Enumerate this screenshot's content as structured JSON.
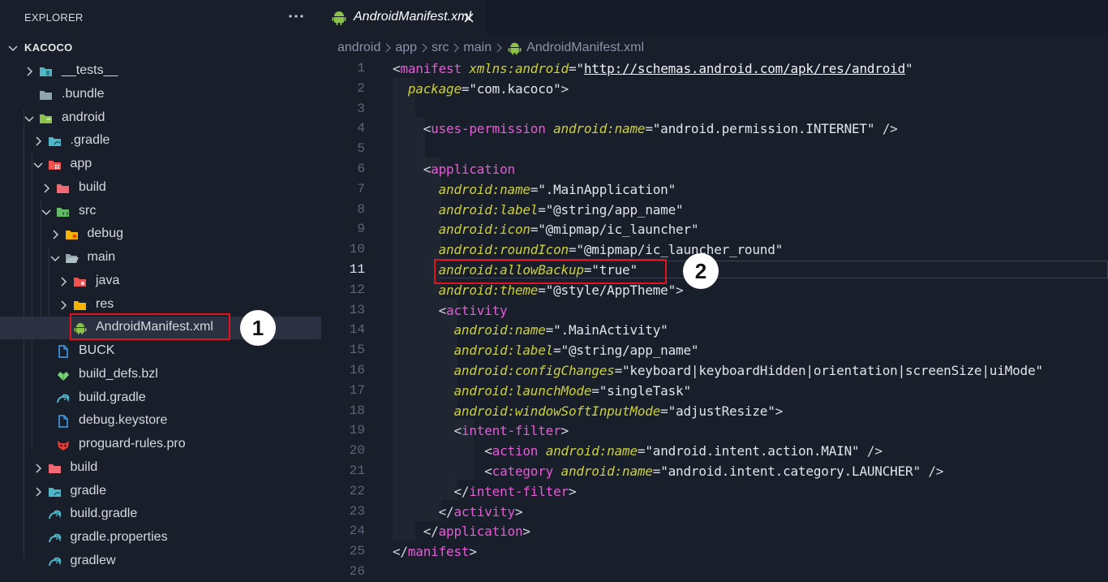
{
  "sidebar": {
    "title": "EXPLORER",
    "project": "KACOCO",
    "items": [
      {
        "label": "__tests__",
        "icon": "tests-folder-icon",
        "chevron": "right"
      },
      {
        "label": ".bundle",
        "icon": "folder-icon",
        "chevron": "none"
      },
      {
        "label": "android",
        "icon": "android-folder-icon",
        "chevron": "down"
      },
      {
        "label": ".gradle",
        "icon": "gradle-folder-icon",
        "chevron": "right"
      },
      {
        "label": "app",
        "icon": "app-folder-icon",
        "chevron": "down"
      },
      {
        "label": "build",
        "icon": "build-folder-icon",
        "chevron": "right"
      },
      {
        "label": "src",
        "icon": "src-folder-icon",
        "chevron": "down"
      },
      {
        "label": "debug",
        "icon": "debug-folder-icon",
        "chevron": "right"
      },
      {
        "label": "main",
        "icon": "open-folder-icon",
        "chevron": "down"
      },
      {
        "label": "java",
        "icon": "java-folder-icon",
        "chevron": "right"
      },
      {
        "label": "res",
        "icon": "res-folder-icon",
        "chevron": "right"
      },
      {
        "label": "AndroidManifest.xml",
        "icon": "android-icon",
        "chevron": "none"
      },
      {
        "label": "BUCK",
        "icon": "file-icon",
        "chevron": "none"
      },
      {
        "label": "build_defs.bzl",
        "icon": "bazel-icon",
        "chevron": "none"
      },
      {
        "label": "build.gradle",
        "icon": "gradle-icon",
        "chevron": "none"
      },
      {
        "label": "debug.keystore",
        "icon": "file-icon",
        "chevron": "none"
      },
      {
        "label": "proguard-rules.pro",
        "icon": "proguard-icon",
        "chevron": "none"
      },
      {
        "label": "build",
        "icon": "build-folder-icon",
        "chevron": "right"
      },
      {
        "label": "gradle",
        "icon": "gradle-folder-icon",
        "chevron": "right"
      },
      {
        "label": "build.gradle",
        "icon": "gradle-icon",
        "chevron": "none"
      },
      {
        "label": "gradle.properties",
        "icon": "gradle-icon",
        "chevron": "none"
      },
      {
        "label": "gradlew",
        "icon": "gradle-icon",
        "chevron": "none"
      }
    ]
  },
  "tab": {
    "label": "AndroidManifest.xml",
    "icon": "android-icon"
  },
  "breadcrumb": [
    "android",
    "app",
    "src",
    "main",
    "AndroidManifest.xml"
  ],
  "editor": {
    "active_line": 11,
    "lines": [
      {
        "n": "1",
        "tokens": [
          [
            "t",
            "<"
          ],
          [
            "g",
            "manifest"
          ],
          [
            "t",
            " "
          ],
          [
            "a",
            "xmlns:android"
          ],
          [
            "t",
            "="
          ],
          [
            "s",
            "\""
          ],
          [
            "u",
            "http://schemas.android.com/apk/res/android"
          ],
          [
            "s",
            "\""
          ]
        ]
      },
      {
        "n": "2",
        "tokens": [
          [
            "t",
            "  "
          ],
          [
            "a",
            "package"
          ],
          [
            "t",
            "="
          ],
          [
            "s",
            "\"com.kacoco\""
          ],
          [
            "t",
            ">"
          ]
        ]
      },
      {
        "n": "3",
        "tokens": []
      },
      {
        "n": "4",
        "tokens": [
          [
            "t",
            "    <"
          ],
          [
            "g",
            "uses-permission"
          ],
          [
            "t",
            " "
          ],
          [
            "a",
            "android:name"
          ],
          [
            "t",
            "="
          ],
          [
            "s",
            "\"android.permission.INTERNET\""
          ],
          [
            "t",
            " />"
          ]
        ]
      },
      {
        "n": "5",
        "tokens": []
      },
      {
        "n": "6",
        "tokens": [
          [
            "t",
            "    <"
          ],
          [
            "g",
            "application"
          ]
        ]
      },
      {
        "n": "7",
        "tokens": [
          [
            "t",
            "      "
          ],
          [
            "a",
            "android:name"
          ],
          [
            "t",
            "="
          ],
          [
            "s",
            "\".MainApplication\""
          ]
        ]
      },
      {
        "n": "8",
        "tokens": [
          [
            "t",
            "      "
          ],
          [
            "a",
            "android:label"
          ],
          [
            "t",
            "="
          ],
          [
            "s",
            "\"@string/app_name\""
          ]
        ]
      },
      {
        "n": "9",
        "tokens": [
          [
            "t",
            "      "
          ],
          [
            "a",
            "android:icon"
          ],
          [
            "t",
            "="
          ],
          [
            "s",
            "\"@mipmap/ic_launcher\""
          ]
        ]
      },
      {
        "n": "10",
        "tokens": [
          [
            "t",
            "      "
          ],
          [
            "a",
            "android:roundIcon"
          ],
          [
            "t",
            "="
          ],
          [
            "s",
            "\"@mipmap/ic_launcher_round\""
          ]
        ]
      },
      {
        "n": "11",
        "tokens": [
          [
            "t",
            "      "
          ],
          [
            "a",
            "android:allowBackup"
          ],
          [
            "t",
            "="
          ],
          [
            "s",
            "\"true\""
          ]
        ]
      },
      {
        "n": "12",
        "tokens": [
          [
            "t",
            "      "
          ],
          [
            "a",
            "android:theme"
          ],
          [
            "t",
            "="
          ],
          [
            "s",
            "\"@style/AppTheme\""
          ],
          [
            "t",
            ">"
          ]
        ]
      },
      {
        "n": "13",
        "tokens": [
          [
            "t",
            "      <"
          ],
          [
            "g",
            "activity"
          ]
        ]
      },
      {
        "n": "14",
        "tokens": [
          [
            "t",
            "        "
          ],
          [
            "a",
            "android:name"
          ],
          [
            "t",
            "="
          ],
          [
            "s",
            "\".MainActivity\""
          ]
        ]
      },
      {
        "n": "15",
        "tokens": [
          [
            "t",
            "        "
          ],
          [
            "a",
            "android:label"
          ],
          [
            "t",
            "="
          ],
          [
            "s",
            "\"@string/app_name\""
          ]
        ]
      },
      {
        "n": "16",
        "tokens": [
          [
            "t",
            "        "
          ],
          [
            "a",
            "android:configChanges"
          ],
          [
            "t",
            "="
          ],
          [
            "s",
            "\"keyboard|keyboardHidden|orientation|screenSize|uiMode\""
          ]
        ]
      },
      {
        "n": "17",
        "tokens": [
          [
            "t",
            "        "
          ],
          [
            "a",
            "android:launchMode"
          ],
          [
            "t",
            "="
          ],
          [
            "s",
            "\"singleTask\""
          ]
        ]
      },
      {
        "n": "18",
        "tokens": [
          [
            "t",
            "        "
          ],
          [
            "a",
            "android:windowSoftInputMode"
          ],
          [
            "t",
            "="
          ],
          [
            "s",
            "\"adjustResize\""
          ],
          [
            "t",
            ">"
          ]
        ]
      },
      {
        "n": "19",
        "tokens": [
          [
            "t",
            "        <"
          ],
          [
            "g",
            "intent-filter"
          ],
          [
            "t",
            ">"
          ]
        ]
      },
      {
        "n": "20",
        "tokens": [
          [
            "t",
            "            <"
          ],
          [
            "g",
            "action"
          ],
          [
            "t",
            " "
          ],
          [
            "a",
            "android:name"
          ],
          [
            "t",
            "="
          ],
          [
            "s",
            "\"android.intent.action.MAIN\""
          ],
          [
            "t",
            " />"
          ]
        ]
      },
      {
        "n": "21",
        "tokens": [
          [
            "t",
            "            <"
          ],
          [
            "g",
            "category"
          ],
          [
            "t",
            " "
          ],
          [
            "a",
            "android:name"
          ],
          [
            "t",
            "="
          ],
          [
            "s",
            "\"android.intent.category.LAUNCHER\""
          ],
          [
            "t",
            " />"
          ]
        ]
      },
      {
        "n": "22",
        "tokens": [
          [
            "t",
            "        </"
          ],
          [
            "g",
            "intent-filter"
          ],
          [
            "t",
            ">"
          ]
        ]
      },
      {
        "n": "23",
        "tokens": [
          [
            "t",
            "      </"
          ],
          [
            "g",
            "activity"
          ],
          [
            "t",
            ">"
          ]
        ]
      },
      {
        "n": "24",
        "tokens": [
          [
            "t",
            "    </"
          ],
          [
            "g",
            "application"
          ],
          [
            "t",
            ">"
          ]
        ]
      },
      {
        "n": "25",
        "tokens": [
          [
            "t",
            "</"
          ],
          [
            "g",
            "manifest"
          ],
          [
            "t",
            ">"
          ]
        ]
      },
      {
        "n": "26",
        "tokens": []
      }
    ]
  },
  "annotations": [
    {
      "label": "1"
    },
    {
      "label": "2"
    }
  ],
  "colors": {
    "tag": "#e75ad6",
    "attribute": "#ccd03a",
    "background": "#191e2b",
    "highlight": "#e0141c"
  }
}
